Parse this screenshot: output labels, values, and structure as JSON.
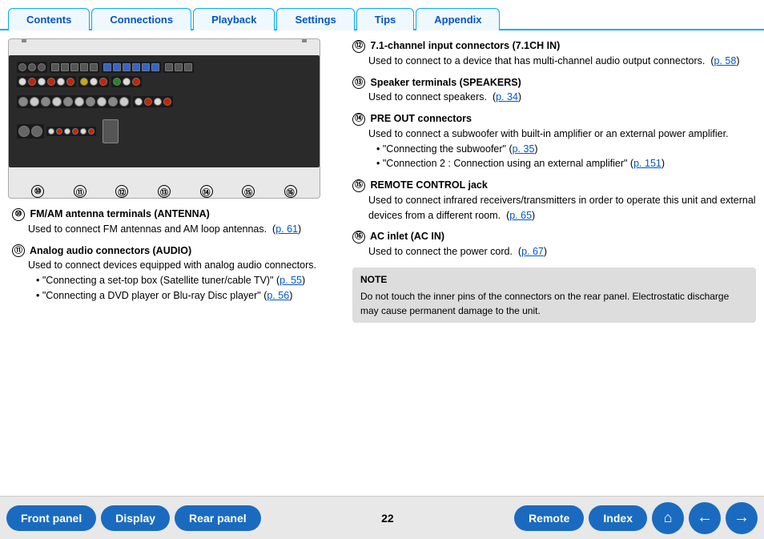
{
  "nav": {
    "tabs": [
      {
        "label": "Contents",
        "id": "tab-contents"
      },
      {
        "label": "Connections",
        "id": "tab-connections"
      },
      {
        "label": "Playback",
        "id": "tab-playback"
      },
      {
        "label": "Settings",
        "id": "tab-settings"
      },
      {
        "label": "Tips",
        "id": "tab-tips"
      },
      {
        "label": "Appendix",
        "id": "tab-appendix"
      }
    ]
  },
  "callouts": {
    "left_nums": [
      "⑩",
      "⑪",
      "⑫",
      "⑬",
      "⑭",
      "⑮",
      "⑯"
    ]
  },
  "left_sections": [
    {
      "num": "⑩",
      "title": "FM/AM antenna terminals (ANTENNA)",
      "body": "Used to connect FM antennas and AM loop antennas.",
      "link": "p. 61",
      "bullets": []
    },
    {
      "num": "⑪",
      "title": "Analog audio connectors (AUDIO)",
      "body": "Used to connect devices equipped with analog audio connectors.",
      "link": "",
      "bullets": [
        {
          "text": "\"Connecting a set-top box (Satellite tuner/cable TV)\"",
          "link": "p. 55"
        },
        {
          "text": "\"Connecting a DVD player or Blu-ray Disc player\"",
          "link": "p. 56"
        }
      ]
    }
  ],
  "right_sections": [
    {
      "num": "⑫",
      "title": "7.1-channel input connectors (7.1CH IN)",
      "body": "Used to connect to a device that has multi-channel audio output connectors.",
      "link": "p. 58",
      "bullets": []
    },
    {
      "num": "⑬",
      "title": "Speaker terminals (SPEAKERS)",
      "body": "Used to connect speakers.",
      "link": "p. 34",
      "bullets": []
    },
    {
      "num": "⑭",
      "title": "PRE OUT connectors",
      "body": "Used to connect a subwoofer with built-in amplifier or an external power amplifier.",
      "link": "",
      "bullets": [
        {
          "text": "\"Connecting the subwoofer\"",
          "link": "p. 35"
        },
        {
          "text": "\"Connection 2 : Connection using an external amplifier\"",
          "link": "p. 151"
        }
      ]
    },
    {
      "num": "⑮",
      "title": "REMOTE CONTROL jack",
      "body": "Used to connect infrared receivers/transmitters in order to operate this unit and external devices from a different room.",
      "link": "p. 65",
      "bullets": []
    },
    {
      "num": "⑯",
      "title": "AC inlet (AC IN)",
      "body": "Used to connect the power cord.",
      "link": "p. 67",
      "bullets": []
    }
  ],
  "note": {
    "title": "NOTE",
    "body": "Do not touch the inner pins of the connectors on the rear panel. Electrostatic discharge may cause permanent damage to the unit."
  },
  "bottom": {
    "front_panel": "Front panel",
    "display": "Display",
    "rear_panel": "Rear panel",
    "page_num": "22",
    "remote": "Remote",
    "index": "Index",
    "home_icon": "⌂",
    "back_icon": "←",
    "forward_icon": "→"
  }
}
